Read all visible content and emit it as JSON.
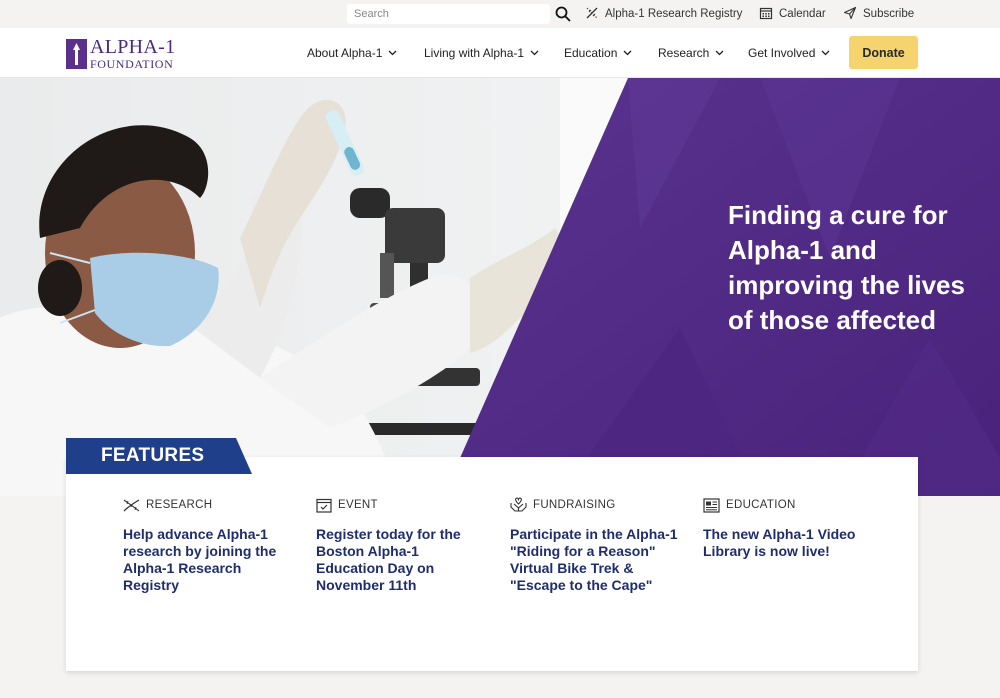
{
  "utility": {
    "search_placeholder": "Search",
    "links": [
      {
        "label": "Alpha-1 Research Registry",
        "icon": "dna-icon"
      },
      {
        "label": "Calendar",
        "icon": "calendar-icon"
      },
      {
        "label": "Subscribe",
        "icon": "paper-plane-icon"
      }
    ]
  },
  "header": {
    "logo_line1": "ALPHA-1",
    "logo_line2": "FOUNDATION",
    "nav": [
      {
        "label": "About Alpha-1"
      },
      {
        "label": "Living with Alpha-1"
      },
      {
        "label": "Education"
      },
      {
        "label": "Research"
      },
      {
        "label": "Get Involved"
      }
    ],
    "donate_label": "Donate"
  },
  "hero": {
    "heading": "Finding a cure for Alpha-1 and improving the lives of those affected"
  },
  "features": {
    "tab_label": "FEATURES",
    "items": [
      {
        "category": "RESEARCH",
        "icon": "dna-icon",
        "title": "Help advance Alpha-1 research by joining the Alpha-1 Research Registry"
      },
      {
        "category": "EVENT",
        "icon": "calendar-check-icon",
        "title": "Register today for the Boston Alpha-1 Education Day on November 11th"
      },
      {
        "category": "FUNDRAISING",
        "icon": "hands-heart-icon",
        "title": "Participate in the Alpha-1 \"Riding for a Reason\" Virtual Bike Trek & \"Escape to the Cape\""
      },
      {
        "category": "EDUCATION",
        "icon": "newspaper-icon",
        "title": "The new Alpha-1 Video Library is now live!"
      }
    ]
  },
  "colors": {
    "brand_purple": "#4f2a85",
    "features_navy": "#1f3f8a",
    "donate_yellow": "#f5d36e",
    "link_navy": "#1f2d6e"
  }
}
